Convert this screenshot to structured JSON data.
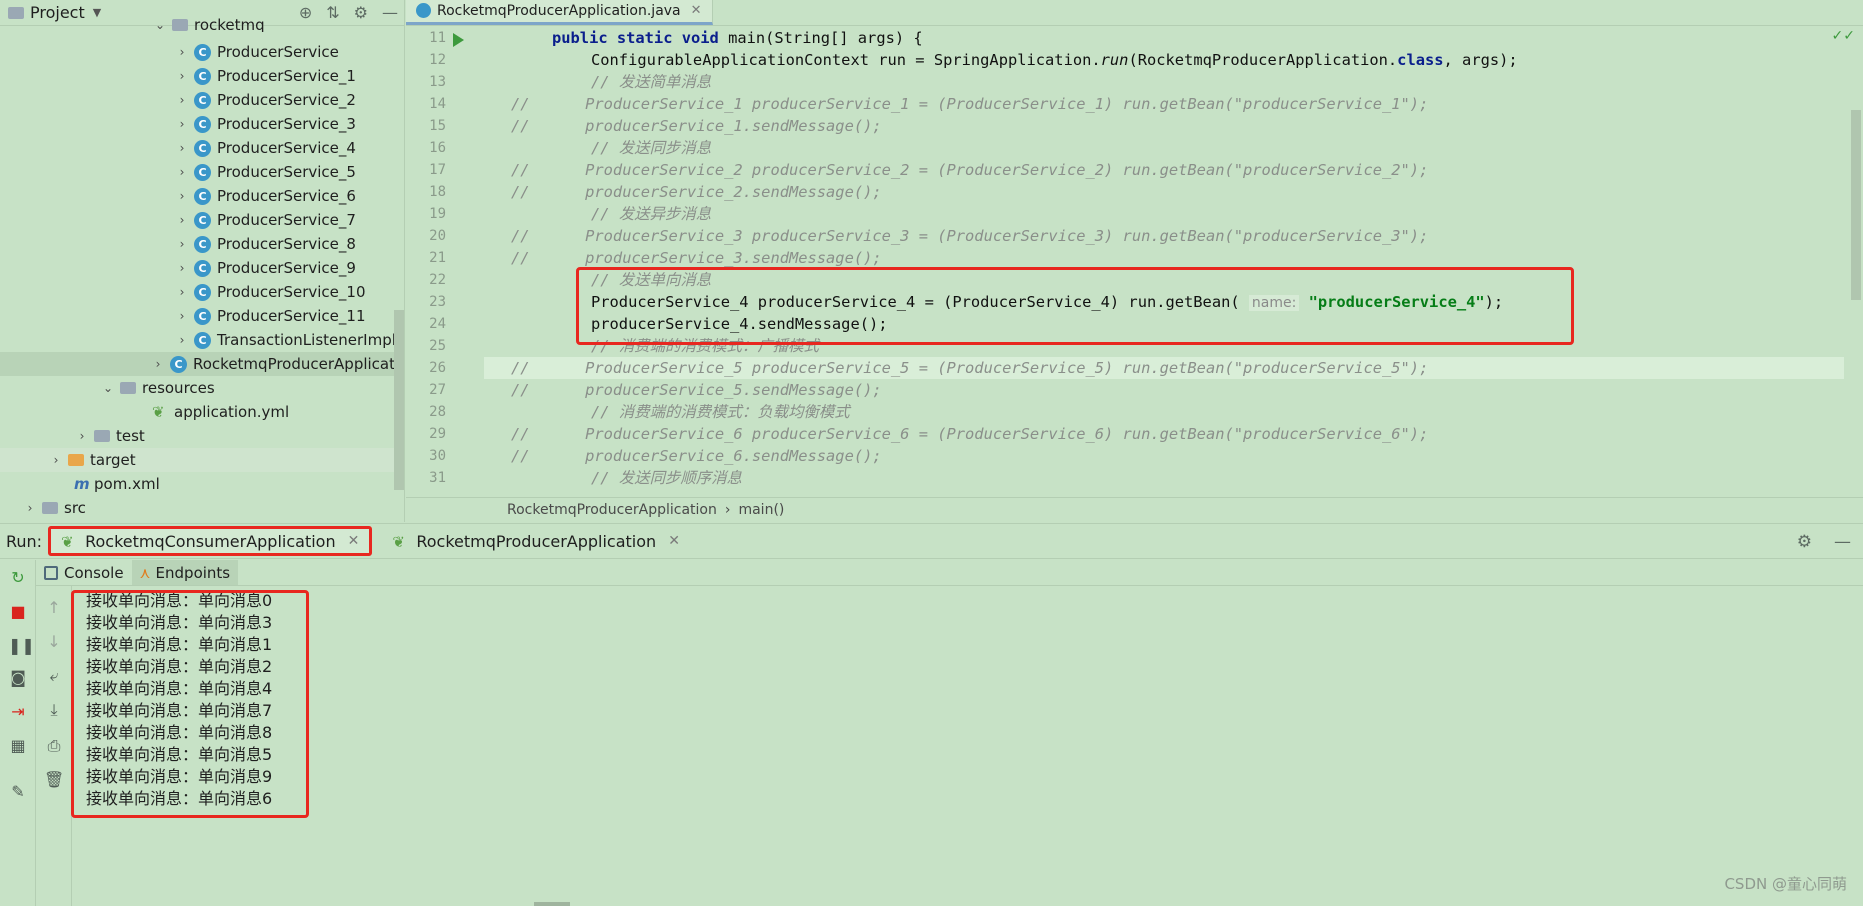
{
  "project": {
    "title": "Project",
    "truncated_top_folder": "rocketmq",
    "classes": [
      "ProducerService",
      "ProducerService_1",
      "ProducerService_2",
      "ProducerService_3",
      "ProducerService_4",
      "ProducerService_5",
      "ProducerService_6",
      "ProducerService_7",
      "ProducerService_8",
      "ProducerService_9",
      "ProducerService_10",
      "ProducerService_11",
      "TransactionListenerImpl"
    ],
    "selected_class": "RocketmqProducerApplicati",
    "resources": "resources",
    "application_yml": "application.yml",
    "test": "test",
    "target": "target",
    "pom": "pom.xml",
    "src": "src"
  },
  "editor": {
    "tab_label": "RocketmqProducerApplication.java",
    "line_numbers": [
      "11",
      "12",
      "13",
      "14",
      "15",
      "16",
      "17",
      "18",
      "19",
      "20",
      "21",
      "22",
      "23",
      "24",
      "25",
      "26",
      "27",
      "28",
      "29",
      "30",
      "31"
    ],
    "breadcrumb": [
      "RocketmqProducerApplication",
      "main()"
    ],
    "hint_name": "name:",
    "highlight_string": "\"producerService_4\""
  },
  "run": {
    "label": "Run:",
    "tabs": [
      "RocketmqConsumerApplication",
      "RocketmqProducerApplication"
    ],
    "console_tab": "Console",
    "endpoints_tab": "Endpoints",
    "output": [
      "接收单向消息：单向消息0",
      "接收单向消息：单向消息3",
      "接收单向消息：单向消息1",
      "接收单向消息：单向消息2",
      "接收单向消息：单向消息4",
      "接收单向消息：单向消息7",
      "接收单向消息：单向消息8",
      "接收单向消息：单向消息5",
      "接收单向消息：单向消息9",
      "接收单向消息：单向消息6"
    ]
  },
  "watermark": "CSDN @童心同萌",
  "colors": {
    "background": "#c7e2c6",
    "highlight_red": "#e8271f",
    "keyword": "#0a1e8c",
    "string": "#067d17"
  }
}
